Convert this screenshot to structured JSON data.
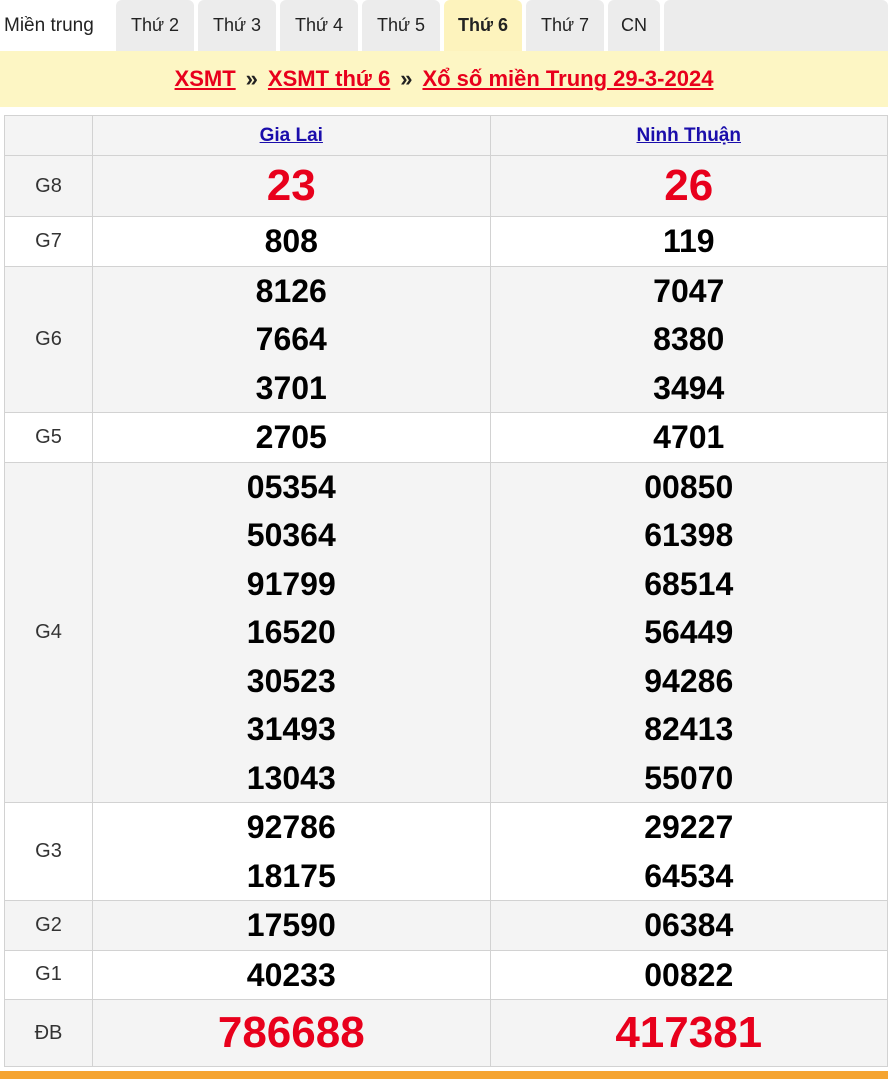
{
  "tabs": {
    "region": "Miền trung",
    "days": [
      "Thứ 2",
      "Thứ 3",
      "Thứ 4",
      "Thứ 5",
      "Thứ 6",
      "Thứ 7",
      "CN"
    ],
    "active_index": 4
  },
  "breadcrumb": {
    "home": "XSMT",
    "sep1": "»",
    "day": "XSMT thứ 6",
    "sep2": "»",
    "current": "Xổ số miền Trung 29-3-2024"
  },
  "provinces": [
    "Gia Lai",
    "Ninh Thuận"
  ],
  "prizes": [
    {
      "label": "G8",
      "gia_lai": [
        "23"
      ],
      "ninh_thuan": [
        "26"
      ]
    },
    {
      "label": "G7",
      "gia_lai": [
        "808"
      ],
      "ninh_thuan": [
        "119"
      ]
    },
    {
      "label": "G6",
      "gia_lai": [
        "8126",
        "7664",
        "3701"
      ],
      "ninh_thuan": [
        "7047",
        "8380",
        "3494"
      ]
    },
    {
      "label": "G5",
      "gia_lai": [
        "2705"
      ],
      "ninh_thuan": [
        "4701"
      ]
    },
    {
      "label": "G4",
      "gia_lai": [
        "05354",
        "50364",
        "91799",
        "16520",
        "30523",
        "31493",
        "13043"
      ],
      "ninh_thuan": [
        "00850",
        "61398",
        "68514",
        "56449",
        "94286",
        "82413",
        "55070"
      ]
    },
    {
      "label": "G3",
      "gia_lai": [
        "92786",
        "18175"
      ],
      "ninh_thuan": [
        "29227",
        "64534"
      ]
    },
    {
      "label": "G2",
      "gia_lai": [
        "17590"
      ],
      "ninh_thuan": [
        "06384"
      ]
    },
    {
      "label": "G1",
      "gia_lai": [
        "40233"
      ],
      "ninh_thuan": [
        "00822"
      ]
    },
    {
      "label": "ĐB",
      "gia_lai": [
        "786688"
      ],
      "ninh_thuan": [
        "417381"
      ]
    }
  ],
  "colors": {
    "accent_red": "#e8001c",
    "header_yellow": "#fdf6c4",
    "link_blue": "#1a0dab",
    "bottom_orange": "#f5a431"
  }
}
